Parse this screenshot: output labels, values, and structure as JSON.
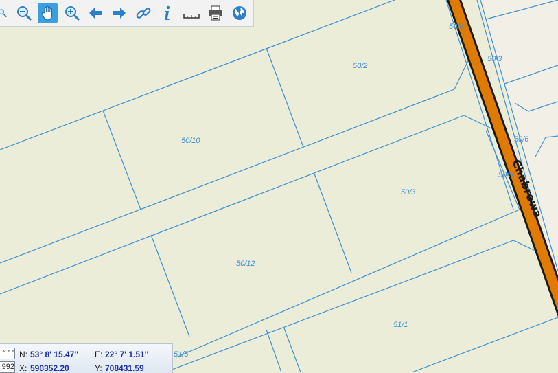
{
  "toolbar": {
    "tools": [
      {
        "name": "zoom-out-magnifier-icon",
        "active": false
      },
      {
        "name": "zoom-out-icon",
        "active": false
      },
      {
        "name": "pan-hand-icon",
        "active": true
      },
      {
        "name": "zoom-in-icon",
        "active": false
      },
      {
        "name": "back-arrow-icon",
        "active": false
      },
      {
        "name": "forward-arrow-icon",
        "active": false
      },
      {
        "name": "link-icon",
        "active": false
      },
      {
        "name": "info-icon",
        "active": false
      },
      {
        "name": "measure-ruler-icon",
        "active": false
      },
      {
        "name": "print-icon",
        "active": false
      },
      {
        "name": "globe-icon",
        "active": false
      }
    ]
  },
  "map": {
    "street_name": "Chabrowa",
    "street_color": "#e07b00",
    "parcel_line_color": "#3d8fd6",
    "background_color": "#ecedd8",
    "parcels": [
      "50/4",
      "50/2",
      "50/3",
      "50/10",
      "50/3",
      "50/6",
      "50/5",
      "50/12",
      "51/1",
      "51/5"
    ]
  },
  "coordinates": {
    "lat_box_value": "° ' \"",
    "xy_box_value": "992",
    "n_label": "N:",
    "n_value": "53° 8' 15.47''",
    "e_label": "E:",
    "e_value": "22° 7' 1.51''",
    "x_label": "X:",
    "x_value": "590352.20",
    "y_label": "Y:",
    "y_value": "708431.59"
  }
}
